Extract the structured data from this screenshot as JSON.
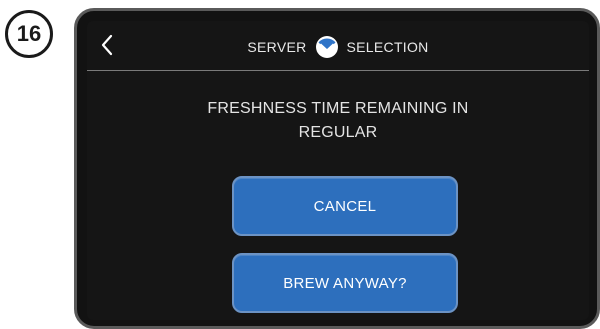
{
  "step": {
    "number": "16"
  },
  "header": {
    "back_icon": "chevron-left-icon",
    "title_left": "SERVER",
    "server_icon": "server-gauge-icon",
    "title_right": "SELECTION"
  },
  "message": {
    "line1": "FRESHNESS TIME REMAINING IN",
    "line2": "REGULAR"
  },
  "buttons": {
    "cancel_label": "CANCEL",
    "brew_anyway_label": "BREW ANYWAY?"
  },
  "colors": {
    "screen_background": "#151515",
    "button_fill": "#2d6fbd",
    "button_border": "#6c93c4",
    "icon_accent": "#2f74c8"
  }
}
